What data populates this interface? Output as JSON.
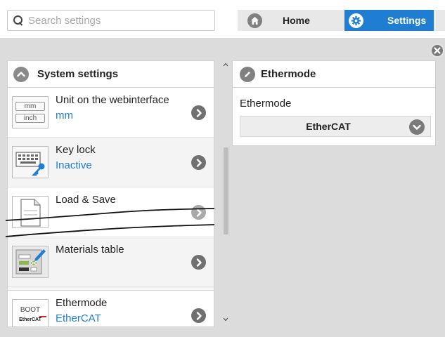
{
  "search": {
    "placeholder": "Search settings",
    "icon": "search-icon"
  },
  "nav": {
    "home_label": "Home",
    "home_icon": "home-icon",
    "settings_label": "Settings",
    "settings_icon": "gear-icon",
    "active": "Settings",
    "accent": "#1f7ed1"
  },
  "left_panel": {
    "title": "System settings",
    "collapse_icon": "chevron-up-icon",
    "items": [
      {
        "label": "Unit on the webinterface",
        "value": "mm",
        "icon": "unit-icon",
        "icon_text": [
          "mm",
          "inch"
        ]
      },
      {
        "label": "Key lock",
        "value": "Inactive",
        "icon": "keyboard-key-icon"
      },
      {
        "label": "Load & Save",
        "value": "",
        "icon": "document-icon"
      },
      {
        "label": "Materials table",
        "value": "",
        "icon": "materials-table-icon"
      },
      {
        "label": "Ethermode",
        "value": "EtherCAT",
        "icon": "ethermode-icon",
        "icon_text": [
          "BOOT",
          "EtherCAT"
        ]
      }
    ]
  },
  "right_panel": {
    "title": "Ethermode",
    "title_icon": "edit-pencil-icon",
    "field_label": "Ethermode",
    "selected": "EtherCAT"
  },
  "colors": {
    "value_text": "#1f7ed1",
    "workspace_bg": "#dcdcdc"
  }
}
